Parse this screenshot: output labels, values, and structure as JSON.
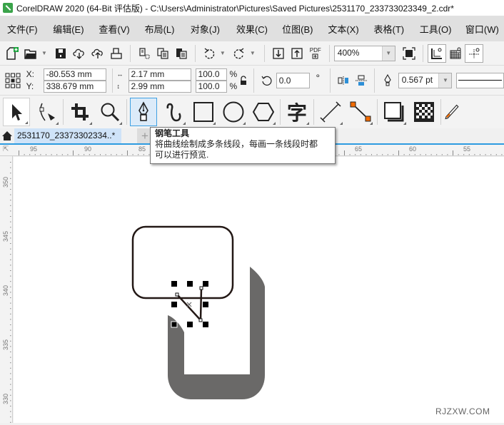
{
  "window": {
    "title": "CorelDRAW 2020 (64-Bit 评估版) - C:\\Users\\Administrator\\Pictures\\Saved Pictures\\2531170_233733023349_2.cdr*"
  },
  "menu": {
    "items": [
      "文件(F)",
      "编辑(E)",
      "查看(V)",
      "布局(L)",
      "对象(J)",
      "效果(C)",
      "位图(B)",
      "文本(X)",
      "表格(T)",
      "工具(O)",
      "窗口(W)"
    ]
  },
  "standard_toolbar": {
    "zoom_level": "400%",
    "pdf_label": "PDF"
  },
  "property_bar": {
    "x_label": "X:",
    "y_label": "Y:",
    "x_value": "-80.553 mm",
    "y_value": "338.679 mm",
    "width_value": "2.17 mm",
    "height_value": "2.99 mm",
    "scale_x": "100.0",
    "scale_y": "100.0",
    "percent": "%",
    "rotation": "0.0",
    "degree": "°",
    "outline_width": "0.567 pt"
  },
  "toolbox": {
    "active_tool": "pen-tool",
    "text_tool_glyph": "字"
  },
  "tooltip": {
    "title": "钢笔工具",
    "line1": "将曲线绘制成多条线段，每画一条线段时都",
    "line2": "可以进行预览."
  },
  "document_tabs": {
    "tabs": [
      {
        "label": "2531170_23373302334..*",
        "active": true
      }
    ],
    "add_label": "+"
  },
  "rulers": {
    "horizontal": [
      "95",
      "90",
      "85",
      "65",
      "60",
      "55"
    ],
    "vertical": [
      "350",
      "345",
      "340",
      "335",
      "330"
    ]
  },
  "canvas": {
    "shape_fill": "#6a6968",
    "outline_color": "#231815"
  },
  "watermark": "RJZXW.COM"
}
